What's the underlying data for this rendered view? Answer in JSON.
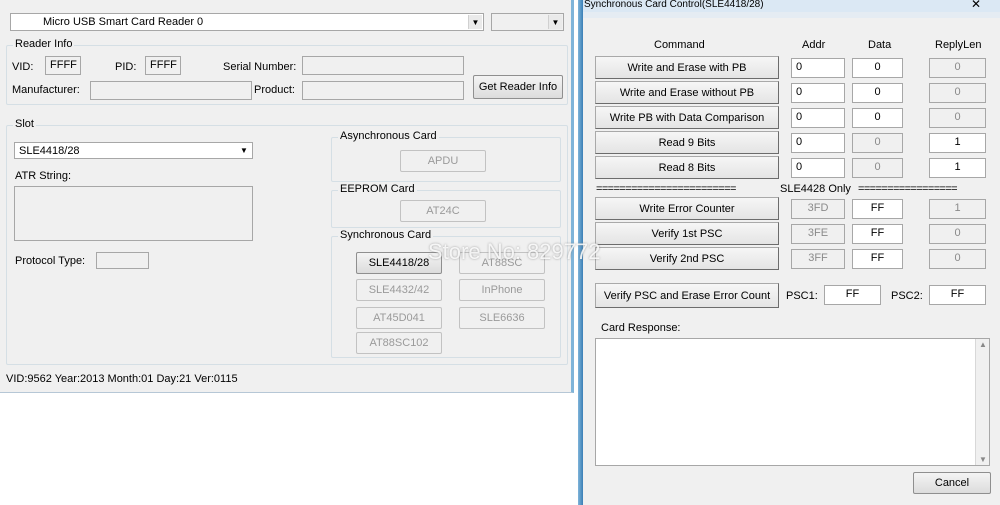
{
  "left": {
    "reader_select": "Micro USB Smart Card Reader 0",
    "reader_info": {
      "caption": "Reader Info",
      "vid_label": "VID:",
      "vid": "FFFF",
      "pid_label": "PID:",
      "pid": "FFFF",
      "serial_label": "Serial Number:",
      "serial": "",
      "manufacturer_label": "Manufacturer:",
      "manufacturer": "",
      "product_label": "Product:",
      "product": "",
      "get_button": "Get Reader Info"
    },
    "slot": {
      "caption": "Slot",
      "card_select": "SLE4418/28",
      "atr_label": "ATR String:",
      "atr": "",
      "protocol_label": "Protocol Type:",
      "protocol": "",
      "async": {
        "caption": "Asynchronous Card",
        "button": "APDU"
      },
      "eeprom": {
        "caption": "EEPROM Card",
        "button": "AT24C"
      },
      "sync": {
        "caption": "Synchronous Card",
        "buttons": [
          "SLE4418/28",
          "AT88SC",
          "SLE4432/42",
          "InPhone",
          "AT45D041",
          "SLE6636",
          "AT88SC102"
        ]
      }
    },
    "status": "VID:9562 Year:2013 Month:01 Day:21 Ver:0115"
  },
  "right": {
    "title": "Synchronous Card Control(SLE4418/28)",
    "headers": {
      "command": "Command",
      "addr": "Addr",
      "data": "Data",
      "replylen": "ReplyLen"
    },
    "rows": [
      {
        "cmd": "Write and Erase with PB",
        "addr": "0",
        "data": "0",
        "reply": "0"
      },
      {
        "cmd": "Write and Erase without PB",
        "addr": "0",
        "data": "0",
        "reply": "0"
      },
      {
        "cmd": "Write PB with Data Comparison",
        "addr": "0",
        "data": "0",
        "reply": "0"
      },
      {
        "cmd": "Read 9 Bits",
        "addr": "0",
        "data": "0",
        "reply": "1"
      },
      {
        "cmd": "Read 8 Bits",
        "addr": "0",
        "data": "0",
        "reply": "1"
      }
    ],
    "separator_left": "========================",
    "separator_mid": "SLE4428 Only",
    "separator_right": "=================",
    "rows2": [
      {
        "cmd": "Write Error Counter",
        "addr": "3FD",
        "data": "FF",
        "reply": "1"
      },
      {
        "cmd": "Verify 1st PSC",
        "addr": "3FE",
        "data": "FF",
        "reply": "0"
      },
      {
        "cmd": "Verify 2nd PSC",
        "addr": "3FF",
        "data": "FF",
        "reply": "0"
      }
    ],
    "verify_button": "Verify PSC and Erase Error Count",
    "psc1_label": "PSC1:",
    "psc1": "FF",
    "psc2_label": "PSC2:",
    "psc2": "FF",
    "response_label": "Card Response:",
    "cancel": "Cancel"
  },
  "watermark": "Store No: 829772"
}
